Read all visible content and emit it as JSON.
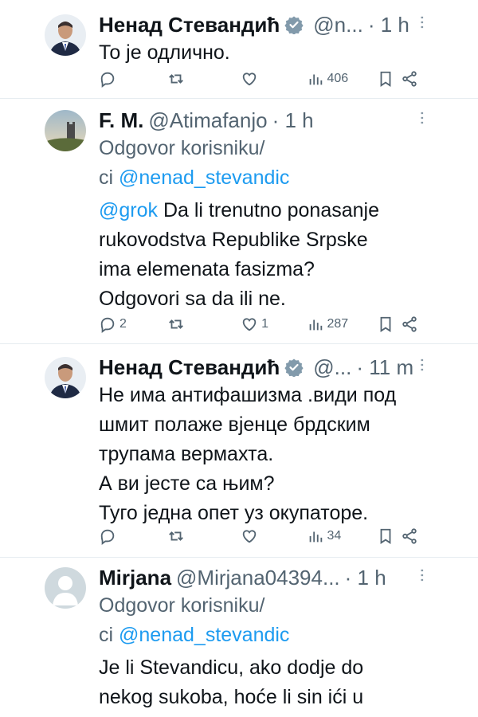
{
  "tweets": [
    {
      "name": "Ненад Стевандић",
      "verified": true,
      "handle": "@n...",
      "time": "· 1 h",
      "reply_prefix": "",
      "reply_mention": "",
      "body": [
        "То је одлично."
      ],
      "replies": "",
      "retweets": "",
      "likes": "",
      "views": "406",
      "avatar": "man-in-suit"
    },
    {
      "name": "F. M.",
      "verified": false,
      "handle": "@Atimafanjo",
      "time": "· 1 h",
      "reply_prefix_1": "Odgovor korisniku/",
      "reply_prefix_2": "ci",
      "reply_mention": "@nenad_stevandic",
      "mention": "@grok",
      "body": [
        " Da li trenutno ponasanje",
        "rukovodstva Republike Srpske",
        "ima elemenata fasizma?",
        "Odgovori sa da ili ne."
      ],
      "replies": "2",
      "retweets": "",
      "likes": "1",
      "views": "287",
      "avatar": "castle-landscape"
    },
    {
      "name": "Ненад Стевандић",
      "verified": true,
      "handle": "@...",
      "time": "· 11 m",
      "body": [
        "Не има антифашизма .види под",
        "шмит полаже вјенце брдским",
        "трупама вермахта.",
        "А ви јесте са њим?",
        "Туго једна опет уз окупаторе."
      ],
      "replies": "",
      "retweets": "",
      "likes": "",
      "views": "34",
      "avatar": "man-in-suit"
    },
    {
      "name": "Mirjana",
      "verified": false,
      "handle": "@Mirjana04394...",
      "time": "· 1 h",
      "reply_prefix_1": "Odgovor korisniku/",
      "reply_prefix_2": "ci",
      "reply_mention": "@nenad_stevandic",
      "body": [
        "Je li Stevandicu, ako dodje do",
        "nekog sukoba, hoće li sin ići u"
      ],
      "avatar": "default-avatar"
    }
  ],
  "colors": {
    "accent": "#1d9bf0",
    "muted": "#536471",
    "divider": "#e6ecf0"
  }
}
